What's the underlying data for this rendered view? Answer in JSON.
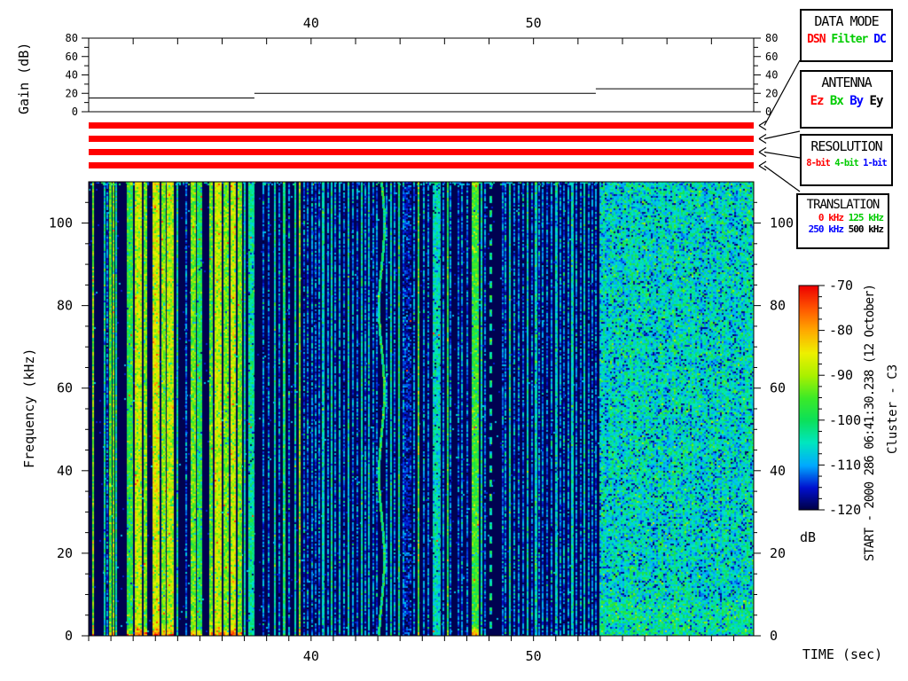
{
  "page": {
    "background": "#ffffff"
  },
  "annotations": {
    "start_label": "START - 2000 286 06:41:30.238 (12 October)",
    "spacecraft": "Cluster - C3",
    "colorbar_unit": "dB",
    "time_axis_label": "TIME (sec)",
    "gain_axis_label": "Gain (dB)",
    "freq_axis_label": "Frequency (kHz)"
  },
  "legend_boxes": [
    {
      "id": "data-mode",
      "title": "DATA MODE",
      "items": [
        {
          "label": "DSN",
          "color": "#ff0000"
        },
        {
          "label": "Filter",
          "color": "#00cc00"
        },
        {
          "label": "DC",
          "color": "#0000ff"
        }
      ]
    },
    {
      "id": "antenna",
      "title": "ANTENNA",
      "items": [
        {
          "label": "Ez",
          "color": "#ff0000"
        },
        {
          "label": "Bx",
          "color": "#00cc00"
        },
        {
          "label": "By",
          "color": "#0000ff"
        },
        {
          "label": "Ey",
          "color": "#000000"
        }
      ]
    },
    {
      "id": "resolution",
      "title": "RESOLUTION",
      "items": [
        {
          "label": "8-bit",
          "color": "#ff0000"
        },
        {
          "label": "4-bit",
          "color": "#00cc00"
        },
        {
          "label": "1-bit",
          "color": "#0000ff"
        }
      ]
    },
    {
      "id": "translation",
      "title": "TRANSLATION",
      "rows": [
        [
          {
            "label": "0 kHz",
            "color": "#ff0000"
          },
          {
            "label": "125 kHz",
            "color": "#00cc00"
          }
        ],
        [
          {
            "label": "250 kHz",
            "color": "#0000ff"
          },
          {
            "label": "500 kHz",
            "color": "#000000"
          }
        ]
      ]
    }
  ],
  "status_bars": {
    "count": 4,
    "color": "#ff0000",
    "selected": {
      "data_mode": "DSN",
      "antenna": "Ez",
      "resolution": "8-bit",
      "translation": "0 kHz"
    }
  },
  "chart_data": [
    {
      "type": "line",
      "name": "gain",
      "ylabel": "Gain (dB)",
      "ylim": [
        0,
        80
      ],
      "yticks": [
        0,
        20,
        40,
        60,
        80
      ],
      "ytick_minor_step": 10,
      "xlim": [
        30.0,
        59.9
      ],
      "xtick_step": 2,
      "xtick_labels": [
        40,
        50
      ],
      "series": [
        {
          "name": "gain_db",
          "steps": [
            {
              "t0": 30.0,
              "t1": 37.45,
              "db": 15
            },
            {
              "t0": 37.45,
              "t1": 52.8,
              "db": 20
            },
            {
              "t0": 52.8,
              "t1": 59.9,
              "db": 25
            }
          ]
        }
      ]
    },
    {
      "type": "heatmap",
      "name": "spectrogram",
      "ylabel": "Frequency (kHz)",
      "xlabel": "TIME (sec)",
      "ylim": [
        0,
        110
      ],
      "yticks": [
        0,
        20,
        40,
        60,
        80,
        100
      ],
      "ytick_minor_step": 5,
      "xlim": [
        30.0,
        59.9
      ],
      "xtick_step": 1,
      "xtick_labels": [
        40,
        50
      ],
      "colorbar": {
        "unit": "dB",
        "min": -120,
        "max": -70,
        "ticks": [
          -70,
          -80,
          -90,
          -100,
          -110,
          -120
        ],
        "minor_step": 2.5,
        "stops": [
          [
            -120,
            "#000042"
          ],
          [
            -115,
            "#0010d0"
          ],
          [
            -110,
            "#00aaff"
          ],
          [
            -105,
            "#00e6c0"
          ],
          [
            -100,
            "#0ce05a"
          ],
          [
            -95,
            "#3cea28"
          ],
          [
            -90,
            "#aaf000"
          ],
          [
            -85,
            "#eef000"
          ],
          [
            -80,
            "#ffaa00"
          ],
          [
            -75,
            "#ff5500"
          ],
          [
            -70,
            "#ee0000"
          ]
        ]
      },
      "background_db": -119.5,
      "seed": 1270,
      "noise_region": {
        "t0": 52.95,
        "t1": 59.9,
        "mean_db": -106,
        "sd_db": 4.5
      },
      "stripes": [
        [
          30.2,
          2,
          -93
        ],
        [
          30.72,
          2,
          -105
        ],
        [
          30.84,
          2,
          -113
        ],
        [
          30.96,
          3,
          -96
        ],
        [
          31.12,
          2,
          -94
        ],
        [
          31.24,
          2,
          -104
        ],
        [
          31.85,
          7,
          -97
        ],
        [
          32.23,
          8,
          -88
        ],
        [
          32.55,
          4,
          -93
        ],
        [
          33.03,
          8,
          -87
        ],
        [
          33.33,
          5,
          -92
        ],
        [
          33.67,
          8,
          -89
        ],
        [
          33.98,
          2,
          -104
        ],
        [
          34.38,
          2,
          -113
        ],
        [
          34.7,
          6,
          -93
        ],
        [
          34.98,
          6,
          -99
        ],
        [
          35.5,
          4,
          -94
        ],
        [
          35.82,
          8,
          -88
        ],
        [
          36.18,
          6,
          -93
        ],
        [
          36.49,
          6,
          -88
        ],
        [
          36.79,
          5,
          -93
        ],
        [
          37.01,
          2,
          -104
        ],
        [
          37.31,
          7,
          -103
        ],
        [
          37.85,
          2,
          -113
        ],
        [
          38.09,
          2,
          -113
        ],
        [
          38.37,
          2,
          -105
        ],
        [
          38.57,
          2,
          -113
        ],
        [
          38.76,
          3,
          -101
        ],
        [
          39.0,
          2,
          -113
        ],
        [
          39.28,
          2,
          -105
        ],
        [
          39.48,
          2,
          -93
        ],
        [
          39.68,
          2,
          -113
        ],
        [
          39.84,
          2,
          -113
        ],
        [
          40.05,
          2,
          -112
        ],
        [
          40.21,
          2,
          -113
        ],
        [
          40.37,
          2,
          -112
        ],
        [
          40.53,
          3,
          -106
        ],
        [
          40.76,
          2,
          -112
        ],
        [
          40.92,
          2,
          -105
        ],
        [
          41.08,
          2,
          -112
        ],
        [
          41.28,
          2,
          -109
        ],
        [
          41.48,
          2,
          -113
        ],
        [
          41.68,
          2,
          -106
        ],
        [
          41.88,
          2,
          -112
        ],
        [
          42.08,
          2,
          -113
        ],
        [
          42.28,
          2,
          -105
        ],
        [
          42.44,
          2,
          -112
        ],
        [
          42.6,
          2,
          -108
        ],
        [
          42.8,
          2,
          -112
        ],
        [
          42.96,
          2,
          -113
        ],
        [
          43.16,
          3,
          -101,
          "w"
        ],
        [
          43.4,
          2,
          -112
        ],
        [
          43.6,
          2,
          -106
        ],
        [
          43.76,
          2,
          -112
        ],
        [
          43.95,
          2,
          -102
        ],
        [
          44.15,
          2,
          -113
        ],
        [
          44.35,
          8,
          -116
        ],
        [
          44.63,
          2,
          -112
        ],
        [
          44.83,
          2,
          -97
        ],
        [
          45.07,
          2,
          -112
        ],
        [
          45.27,
          2,
          -113
        ],
        [
          45.63,
          9,
          -105
        ],
        [
          45.95,
          2,
          -112
        ],
        [
          46.15,
          2,
          -99
        ],
        [
          46.27,
          2,
          -112
        ],
        [
          46.61,
          2,
          -113
        ],
        [
          46.77,
          2,
          -112
        ],
        [
          47.01,
          2,
          -113
        ],
        [
          47.37,
          8,
          -96
        ],
        [
          47.65,
          2,
          -105
        ],
        [
          47.81,
          2,
          -113
        ],
        [
          48.05,
          3,
          -104,
          "d"
        ],
        [
          48.61,
          2,
          -113
        ],
        [
          48.73,
          2,
          -112
        ],
        [
          48.92,
          2,
          -104
        ],
        [
          49.12,
          2,
          -113
        ],
        [
          49.32,
          2,
          -112
        ],
        [
          49.52,
          2,
          -113
        ],
        [
          49.72,
          2,
          -106
        ],
        [
          49.92,
          2,
          -113
        ],
        [
          50.08,
          3,
          -106
        ],
        [
          50.24,
          2,
          -113
        ],
        [
          50.4,
          2,
          -112
        ],
        [
          50.6,
          2,
          -113
        ],
        [
          50.8,
          2,
          -112
        ],
        [
          51.0,
          3,
          -107
        ],
        [
          51.2,
          2,
          -112
        ],
        [
          51.35,
          2,
          -113
        ],
        [
          51.55,
          2,
          -112
        ],
        [
          51.71,
          3,
          -106
        ],
        [
          51.91,
          2,
          -112
        ],
        [
          52.11,
          2,
          -113
        ],
        [
          52.27,
          2,
          -107
        ],
        [
          52.47,
          2,
          -112
        ],
        [
          52.63,
          2,
          -113
        ],
        [
          52.79,
          2,
          -112
        ]
      ]
    }
  ]
}
